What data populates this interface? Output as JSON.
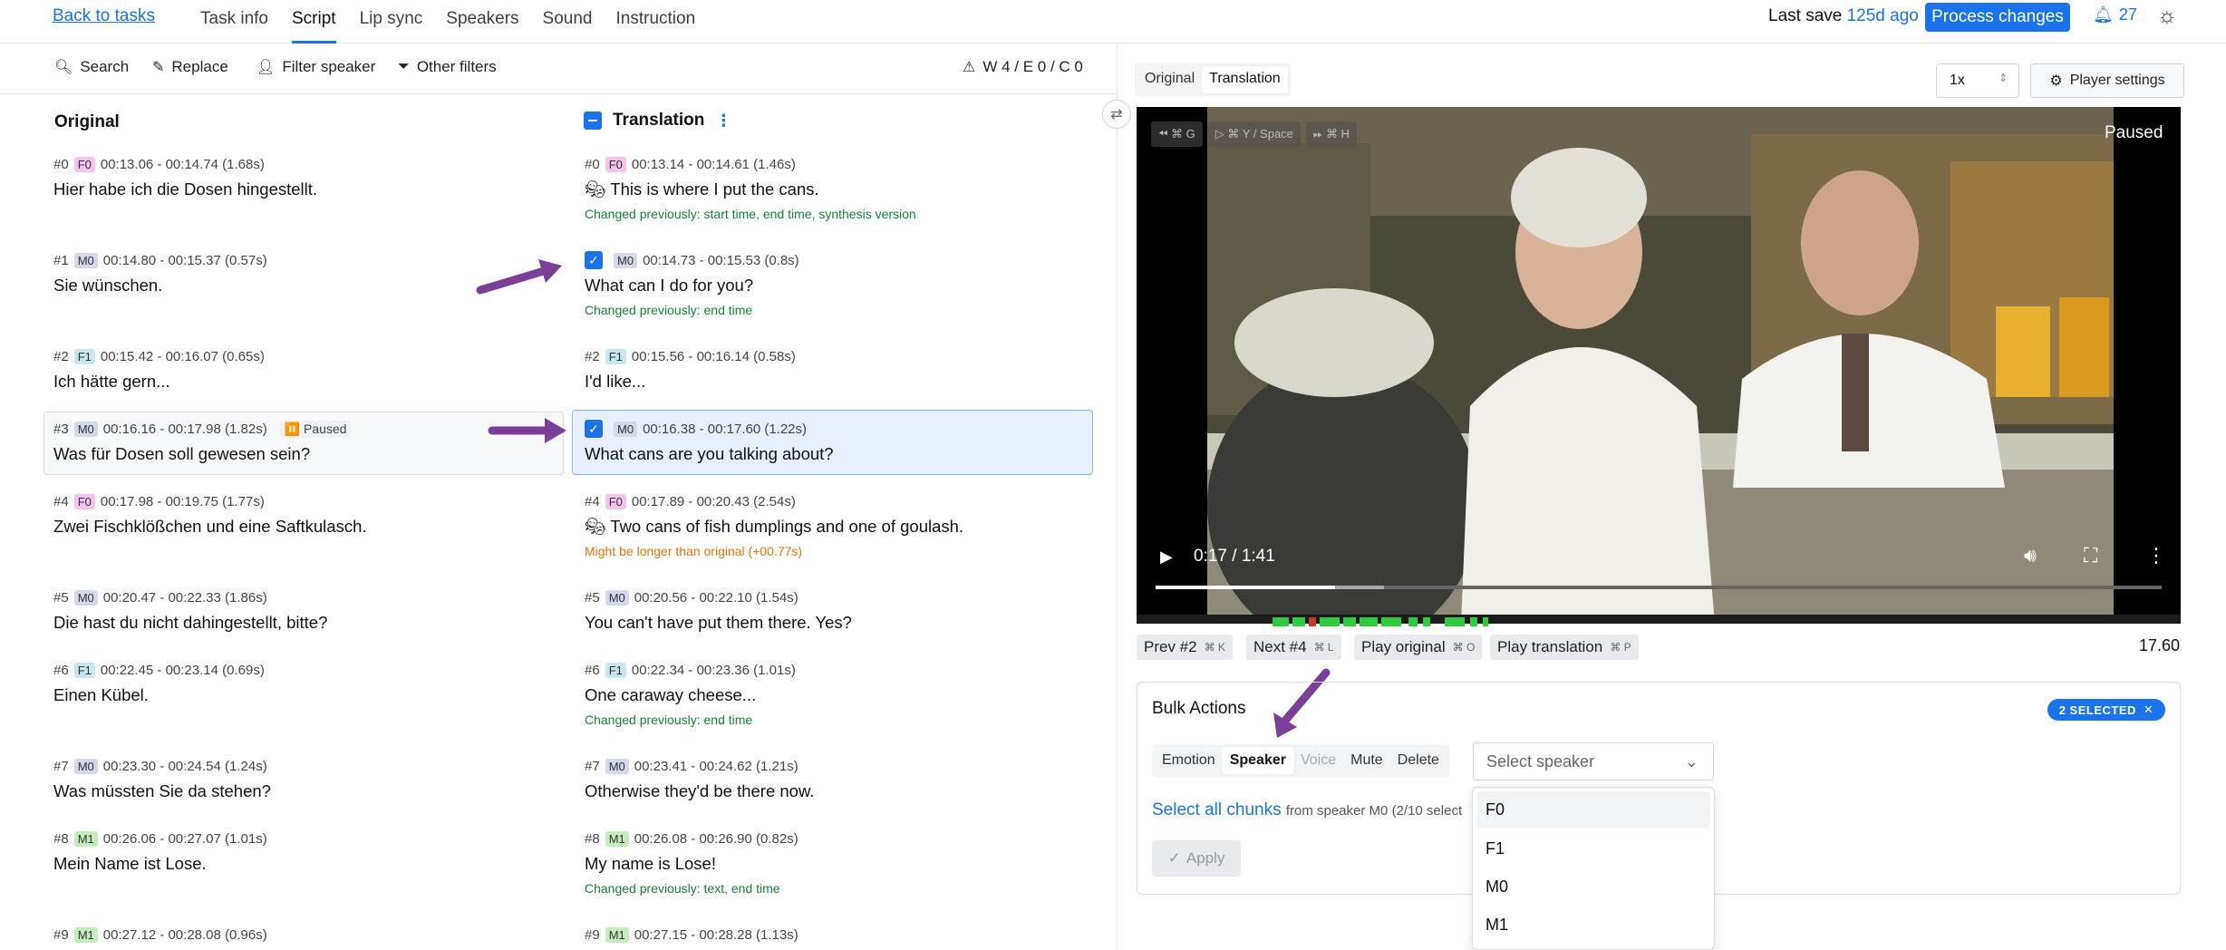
{
  "topbar": {
    "back": "Back to tasks",
    "tabs": [
      "Task info",
      "Script",
      "Lip sync",
      "Speakers",
      "Sound",
      "Instruction"
    ],
    "last_save_label": "Last save",
    "last_save_ago": "125d ago",
    "process": "Process changes",
    "notif_count": "27"
  },
  "toolbar": {
    "search": "Search",
    "replace": "Replace",
    "filter_speaker": "Filter speaker",
    "other_filters": "Other filters",
    "warnings": "W 4 / E 0 / C 0"
  },
  "columns": {
    "original": "Original",
    "translation": "Translation"
  },
  "segments": [
    {
      "o_meta": "#0",
      "o_spk": "F0",
      "o_time": "00:13.06 - 00:14.74 (1.68s)",
      "o_text": "Hier habe ich die Dosen hingestellt.",
      "t_meta": "#0",
      "t_spk": "F0",
      "t_time": "00:13.14 - 00:14.61 (1.46s)",
      "t_text": "This is where I put the cans.",
      "t_note": "Changed previously: start time, end time, synthesis version"
    },
    {
      "o_meta": "#1",
      "o_spk": "M0",
      "o_time": "00:14.80 - 00:15.37 (0.57s)",
      "o_text": "Sie wünschen.",
      "t_meta": "",
      "t_spk": "M0",
      "t_time": "00:14.73 - 00:15.53 (0.8s)",
      "t_text": "What can I do for you?",
      "t_note": "Changed previously: end time"
    },
    {
      "o_meta": "#2",
      "o_spk": "F1",
      "o_time": "00:15.42 - 00:16.07 (0.65s)",
      "o_text": "Ich hätte gern...",
      "t_meta": "#2",
      "t_spk": "F1",
      "t_time": "00:15.56 - 00:16.14 (0.58s)",
      "t_text": "I'd like...",
      "t_note": ""
    },
    {
      "o_meta": "#3",
      "o_spk": "M0",
      "o_time": "00:16.16 - 00:17.98 (1.82s)",
      "o_text": "Was für Dosen soll gewesen sein?",
      "o_badge": "⏸️ Paused",
      "t_meta": "",
      "t_spk": "M0",
      "t_time": "00:16.38 - 00:17.60 (1.22s)",
      "t_text": "What cans are you talking about?",
      "t_note": ""
    },
    {
      "o_meta": "#4",
      "o_spk": "F0",
      "o_time": "00:17.98 - 00:19.75 (1.77s)",
      "o_text": "Zwei Fischklößchen und eine Saftkulasch.",
      "t_meta": "#4",
      "t_spk": "F0",
      "t_time": "00:17.89 - 00:20.43 (2.54s)",
      "t_text": "Two cans of fish dumplings and one of goulash.",
      "t_note": "Might be longer than original (+00.77s)"
    },
    {
      "o_meta": "#5",
      "o_spk": "M0",
      "o_time": "00:20.47 - 00:22.33 (1.86s)",
      "o_text": "Die hast du nicht dahingestellt, bitte?",
      "t_meta": "#5",
      "t_spk": "M0",
      "t_time": "00:20.56 - 00:22.10 (1.54s)",
      "t_text": "You can't have put them there. Yes?",
      "t_note": ""
    },
    {
      "o_meta": "#6",
      "o_spk": "F1",
      "o_time": "00:22.45 - 00:23.14 (0.69s)",
      "o_text": "Einen Kübel.",
      "t_meta": "#6",
      "t_spk": "F1",
      "t_time": "00:22.34 - 00:23.36 (1.01s)",
      "t_text": "One caraway cheese...",
      "t_note": "Changed previously: end time"
    },
    {
      "o_meta": "#7",
      "o_spk": "M0",
      "o_time": "00:23.30 - 00:24.54 (1.24s)",
      "o_text": "Was müssten Sie da stehen?",
      "t_meta": "#7",
      "t_spk": "M0",
      "t_time": "00:23.41 - 00:24.62 (1.21s)",
      "t_text": "Otherwise they'd be there now.",
      "t_note": ""
    },
    {
      "o_meta": "#8",
      "o_spk": "M1",
      "o_time": "00:26.06 - 00:27.07 (1.01s)",
      "o_text": "Mein Name ist Lose.",
      "t_meta": "#8",
      "t_spk": "M1",
      "t_time": "00:26.08 - 00:26.90 (0.82s)",
      "t_text": "My name is Lose!",
      "t_note": "Changed previously: text, end time"
    },
    {
      "o_meta": "#9",
      "o_spk": "M1",
      "o_time": "00:27.12 - 00:28.08 (0.96s)",
      "o_text": "",
      "t_meta": "#9",
      "t_spk": "M1",
      "t_time": "00:27.15 - 00:28.28 (1.13s)",
      "t_text": "",
      "t_note": ""
    }
  ],
  "player": {
    "view_tabs": [
      "Original",
      "Translation"
    ],
    "speed": "1x",
    "settings": "Player settings",
    "rewind": "⌘ G",
    "play_hint": "⌘ Y / Space",
    "ff": "⌘ H",
    "state": "Paused",
    "time": "0:17 / 1:41",
    "progress": 0.178,
    "prev": "Prev #2",
    "prev_kb": "⌘ K",
    "next": "Next #4",
    "next_kb": "⌘ L",
    "play_orig": "Play original",
    "play_orig_kb": "⌘ O",
    "play_trans": "Play translation",
    "play_trans_kb": "⌘ P",
    "value": "17.60"
  },
  "bulk": {
    "title": "Bulk Actions",
    "selected": "2 SELECTED",
    "tabs": [
      "Emotion",
      "Speaker",
      "Voice",
      "Mute",
      "Delete"
    ],
    "select_placeholder": "Select speaker",
    "select_all": "Select all chunks",
    "select_all_sub": "from speaker M0 (2/10 select",
    "apply": "Apply",
    "options": [
      "F0",
      "F1",
      "M0",
      "M1"
    ]
  },
  "colors": {
    "accent": "#1a73e8",
    "annotation_arrow": "#7b3f98"
  }
}
